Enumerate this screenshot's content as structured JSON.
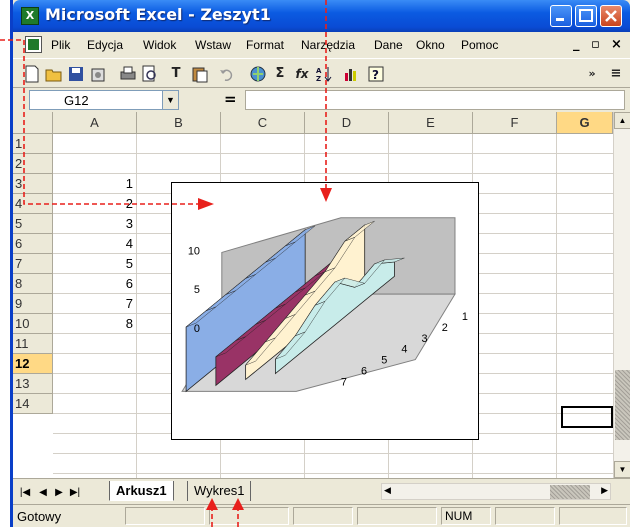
{
  "window": {
    "title": "Microsoft Excel - Zeszyt1",
    "app_icon": "excel-icon"
  },
  "menu": [
    {
      "label": "Plik"
    },
    {
      "label": "Edycja"
    },
    {
      "label": "Widok"
    },
    {
      "label": "Wstaw"
    },
    {
      "label": "Format"
    },
    {
      "label": "Narzędzia"
    },
    {
      "label": "Dane"
    },
    {
      "label": "Okno"
    },
    {
      "label": "Pomoc"
    }
  ],
  "toolbar": {
    "icons": [
      "new-icon",
      "open-icon",
      "save-icon",
      "permission-icon",
      "print-icon",
      "print-preview-icon",
      "bold-t-icon",
      "paste-icon",
      "undo-icon",
      "hyperlink-icon",
      "autosum-icon",
      "function-icon",
      "sort-ascending-icon",
      "chart-wizard-icon",
      "help-icon"
    ],
    "glyphs": {
      "autosum": "Σ",
      "function": "fx",
      "bold_t": "T"
    }
  },
  "formula_bar": {
    "name_box": "G12",
    "equals": "=",
    "formula": ""
  },
  "columns": [
    "A",
    "B",
    "C",
    "D",
    "E",
    "F",
    "G"
  ],
  "rows": [
    "1",
    "2",
    "3",
    "4",
    "5",
    "6",
    "7",
    "8",
    "9",
    "10",
    "11",
    "12",
    "13",
    "14"
  ],
  "cells": {
    "A2": "1",
    "A3": "2",
    "A4": "3",
    "A5": "4",
    "A6": "5",
    "A7": "6",
    "A8": "7",
    "A9": "8"
  },
  "selected_cell": "G12",
  "chart_data": {
    "type": "area",
    "title": "",
    "z_axis_ticks": [
      "0",
      "5",
      "10"
    ],
    "x_axis_ticks": [
      "1",
      "2",
      "3",
      "4",
      "5",
      "6",
      "7"
    ],
    "ylim": [
      0,
      10
    ],
    "grid": false,
    "legend": "none",
    "series": [
      {
        "values": [
          9,
          9,
          9,
          9,
          9,
          9,
          9
        ],
        "color": "#8aaee6"
      },
      {
        "values": [
          4,
          4,
          4,
          4,
          4,
          4,
          4
        ],
        "color": "#993366"
      },
      {
        "values": [
          8,
          8,
          6,
          5,
          4,
          3,
          2
        ],
        "color": "#fff2d0"
      },
      {
        "values": [
          2,
          4,
          3,
          6,
          5,
          3,
          2
        ],
        "color": "#c8ecea"
      }
    ]
  },
  "sheet_tabs": [
    {
      "label": "Arkusz1",
      "active": true
    },
    {
      "label": "Wykres1",
      "active": false
    }
  ],
  "status": {
    "text": "Gotowy",
    "num": "NUM"
  },
  "colors": {
    "titlebar": "#0a4bd4",
    "annotation_arrows": "#e8201c",
    "chart_walls": "#c0c0c0"
  }
}
